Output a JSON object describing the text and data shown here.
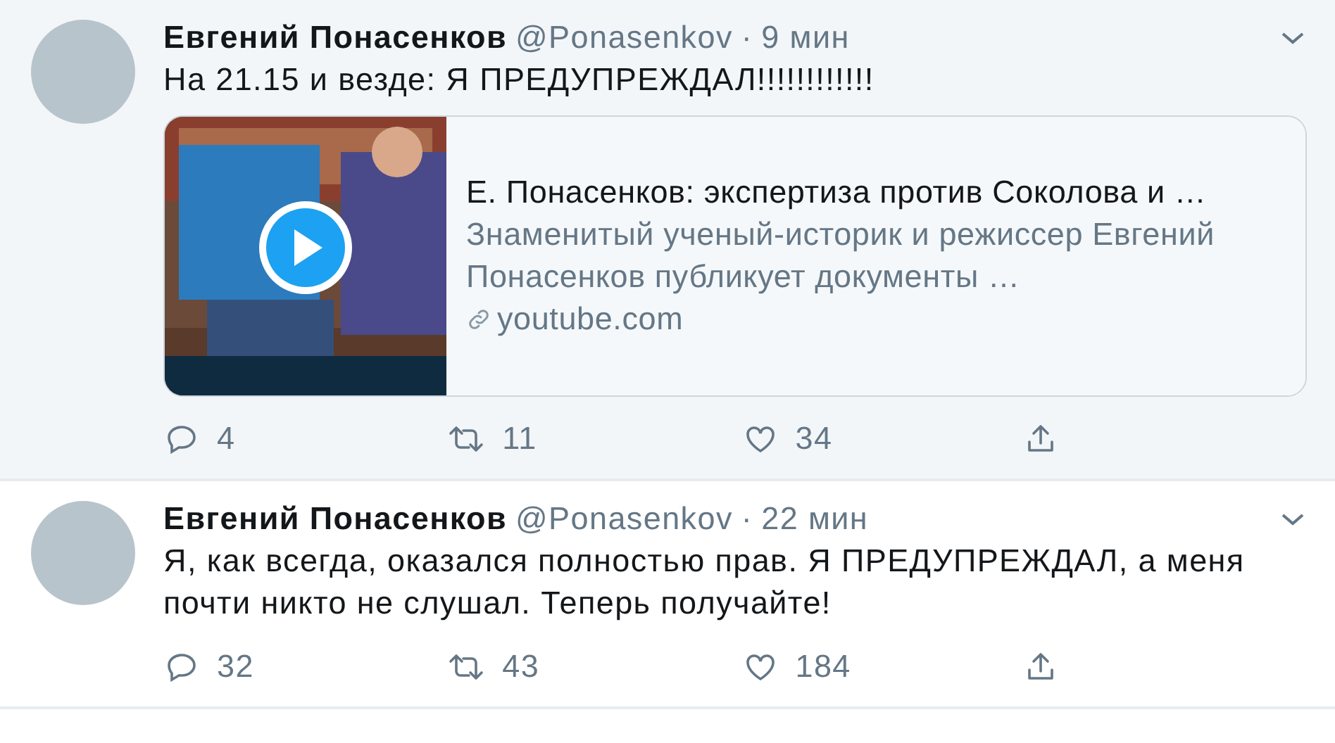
{
  "tweets": [
    {
      "hovered": true,
      "author": "Евгений Понасенков",
      "handle": "@Ponasenkov",
      "separator": "·",
      "time": "9 мин",
      "text": "На 21.15 и везде: Я ПРЕДУПРЕЖДАЛ!!!!!!!!!!!!",
      "card": {
        "title": "Е. Понасенков: экспертиза против Соколова и …",
        "description": "Знаменитый ученый-историк и режиссер Евгений Понасенков публикует документы …",
        "domain": "youtube.com"
      },
      "replies": "4",
      "retweets": "11",
      "likes": "34"
    },
    {
      "hovered": false,
      "author": "Евгений Понасенков",
      "handle": "@Ponasenkov",
      "separator": "·",
      "time": "22 мин",
      "text": "Я, как всегда, оказался полностью прав. Я ПРЕДУПРЕЖДАЛ, а меня почти никто не слушал. Теперь получайте!",
      "replies": "32",
      "retweets": "43",
      "likes": "184"
    }
  ]
}
